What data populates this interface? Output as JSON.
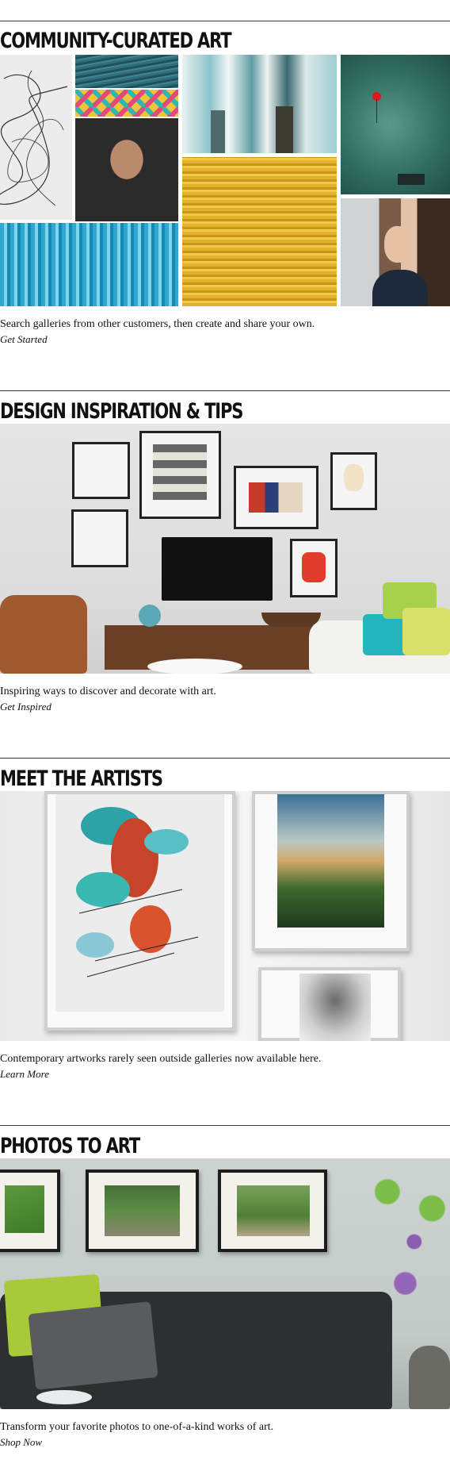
{
  "sections": [
    {
      "title": "COMMUNITY-CURATED ART",
      "description": "Search galleries from other customers, then create and share your own.",
      "link": "Get Started"
    },
    {
      "title": "DESIGN INSPIRATION & TIPS",
      "description": "Inspiring ways to discover and decorate with art.",
      "link": "Get Inspired"
    },
    {
      "title": "MEET THE ARTISTS",
      "description": "Contemporary artworks rarely seen outside galleries now available here.",
      "link": "Learn More"
    },
    {
      "title": "PHOTOS TO ART",
      "description": "Transform your favorite photos to one-of-a-kind works of art.",
      "link": "Shop Now"
    }
  ]
}
